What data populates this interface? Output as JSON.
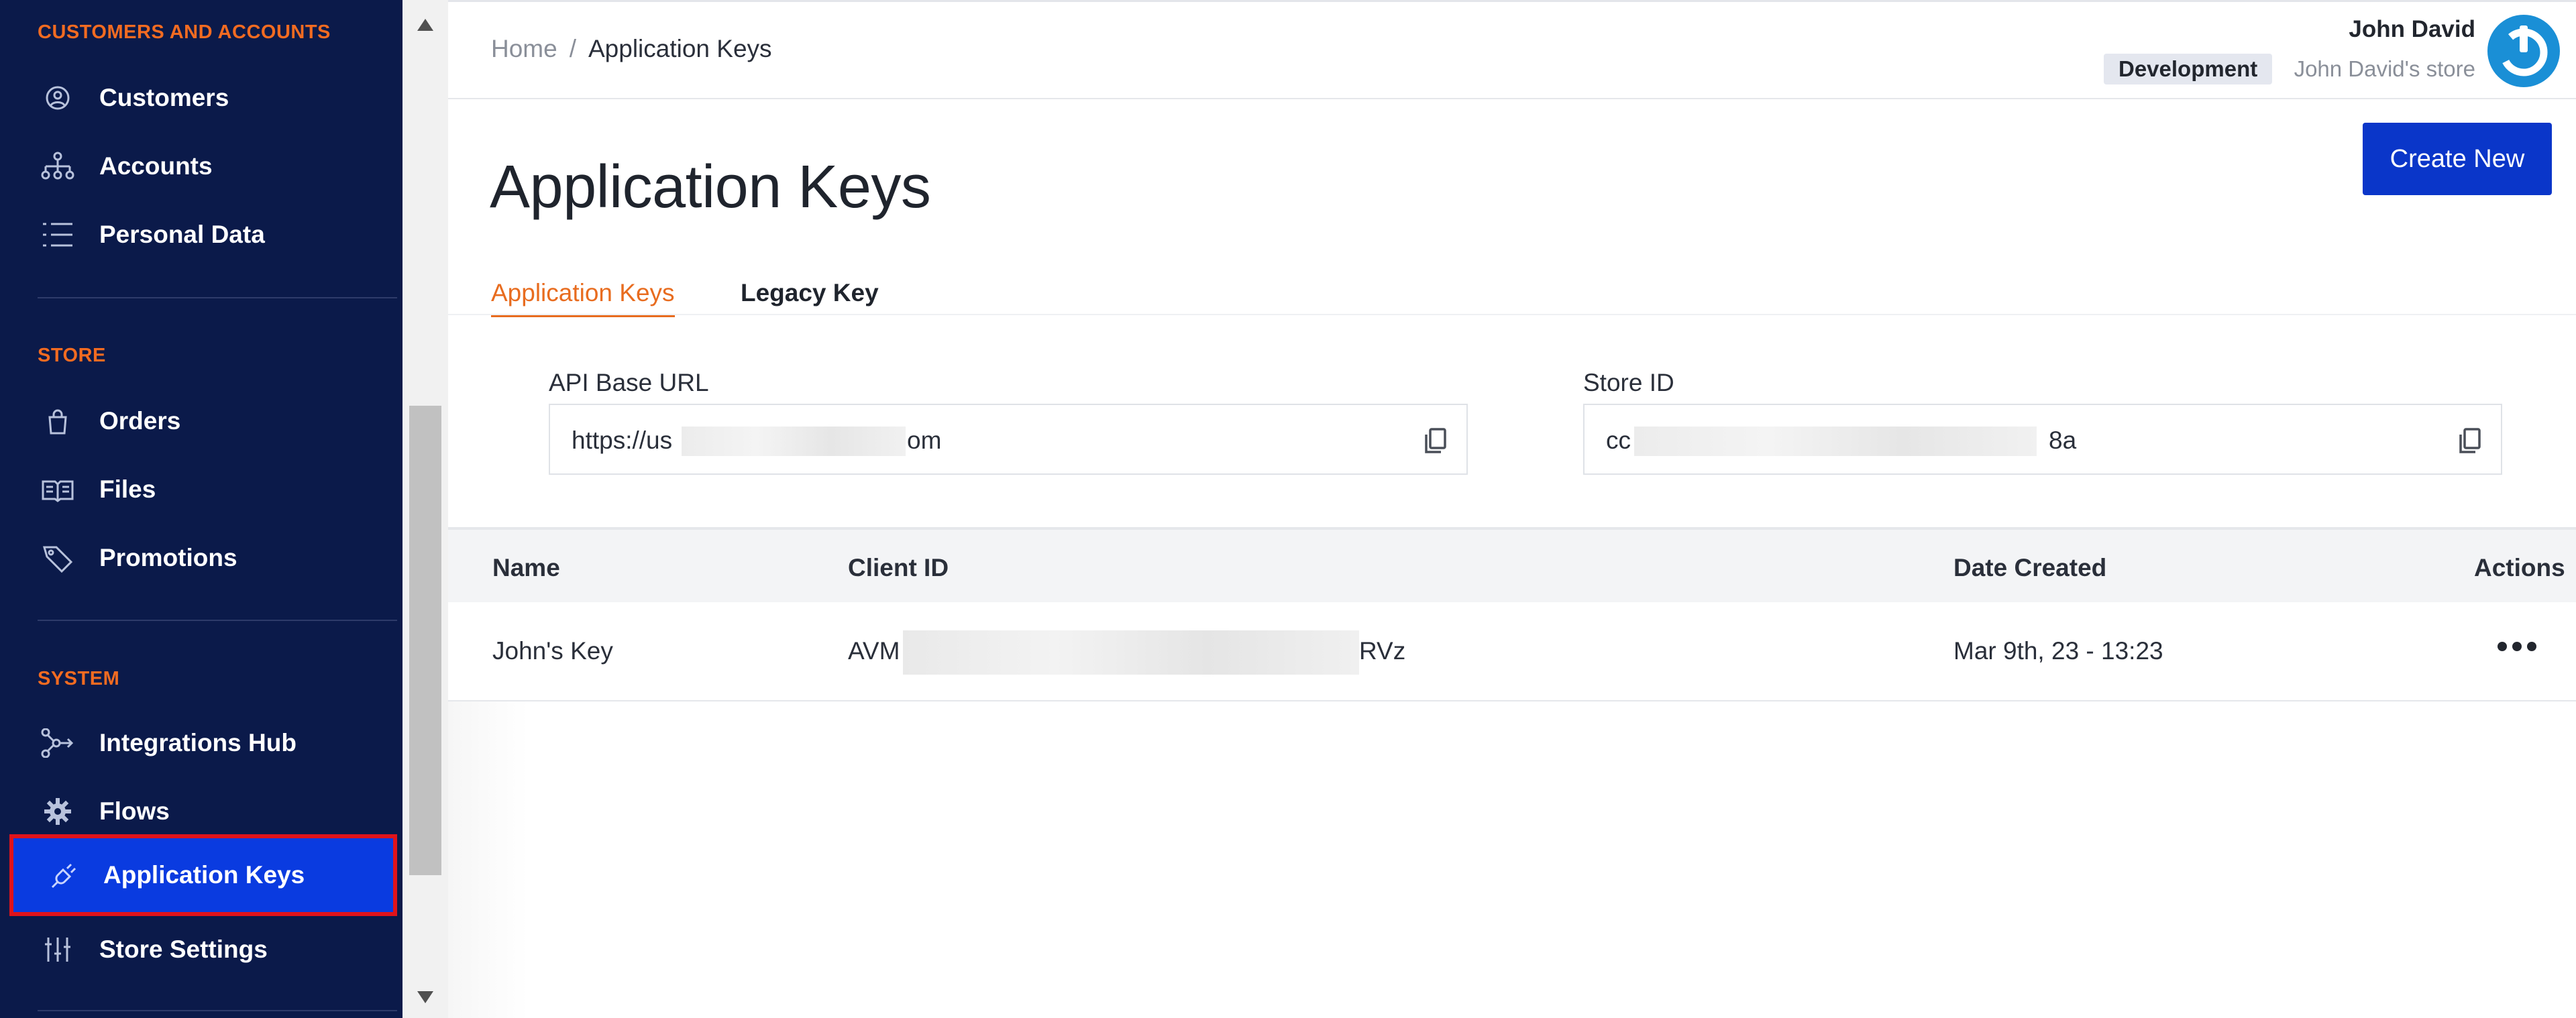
{
  "sidebar": {
    "sections": [
      {
        "label": "CUSTOMERS AND ACCOUNTS"
      },
      {
        "label": "STORE"
      },
      {
        "label": "SYSTEM"
      }
    ],
    "items": [
      {
        "label": "Customers",
        "icon": "user-circle-icon"
      },
      {
        "label": "Accounts",
        "icon": "sitemap-icon"
      },
      {
        "label": "Personal Data",
        "icon": "list-icon"
      },
      {
        "label": "Orders",
        "icon": "shopping-bag-icon"
      },
      {
        "label": "Files",
        "icon": "book-open-icon"
      },
      {
        "label": "Promotions",
        "icon": "tag-icon"
      },
      {
        "label": "Integrations Hub",
        "icon": "hub-icon"
      },
      {
        "label": "Flows",
        "icon": "gear-icon"
      },
      {
        "label": "Application Keys",
        "icon": "plug-icon",
        "active": true
      },
      {
        "label": "Store Settings",
        "icon": "sliders-icon"
      }
    ]
  },
  "breadcrumb": {
    "home": "Home",
    "separator": "/",
    "current": "Application Keys"
  },
  "user": {
    "name": "John David",
    "environment": "Development",
    "store": "John David's store"
  },
  "page": {
    "title": "Application Keys",
    "create_button": "Create New"
  },
  "tabs": [
    {
      "label": "Application Keys",
      "active": true
    },
    {
      "label": "Legacy Key",
      "active": false
    }
  ],
  "fields": {
    "api_base_url": {
      "label": "API Base URL",
      "value_start": "https://us",
      "value_end": "om"
    },
    "store_id": {
      "label": "Store ID",
      "value_start": "cc",
      "value_end": "8a"
    }
  },
  "table": {
    "columns": [
      "Name",
      "Client ID",
      "Date Created",
      "Actions"
    ],
    "rows": [
      {
        "name": "John's Key",
        "client_id_start": "AVM",
        "client_id_end": "RVz",
        "date_created": "Mar 9th, 23 - 13:23"
      }
    ]
  },
  "colors": {
    "sidebar_bg": "#0b1a4a",
    "section_accent": "#f26b21",
    "active_item_bg": "#0a3be0",
    "highlight_border": "#e0131b",
    "primary_button": "#0a36c9",
    "tab_accent": "#e86c1f"
  }
}
